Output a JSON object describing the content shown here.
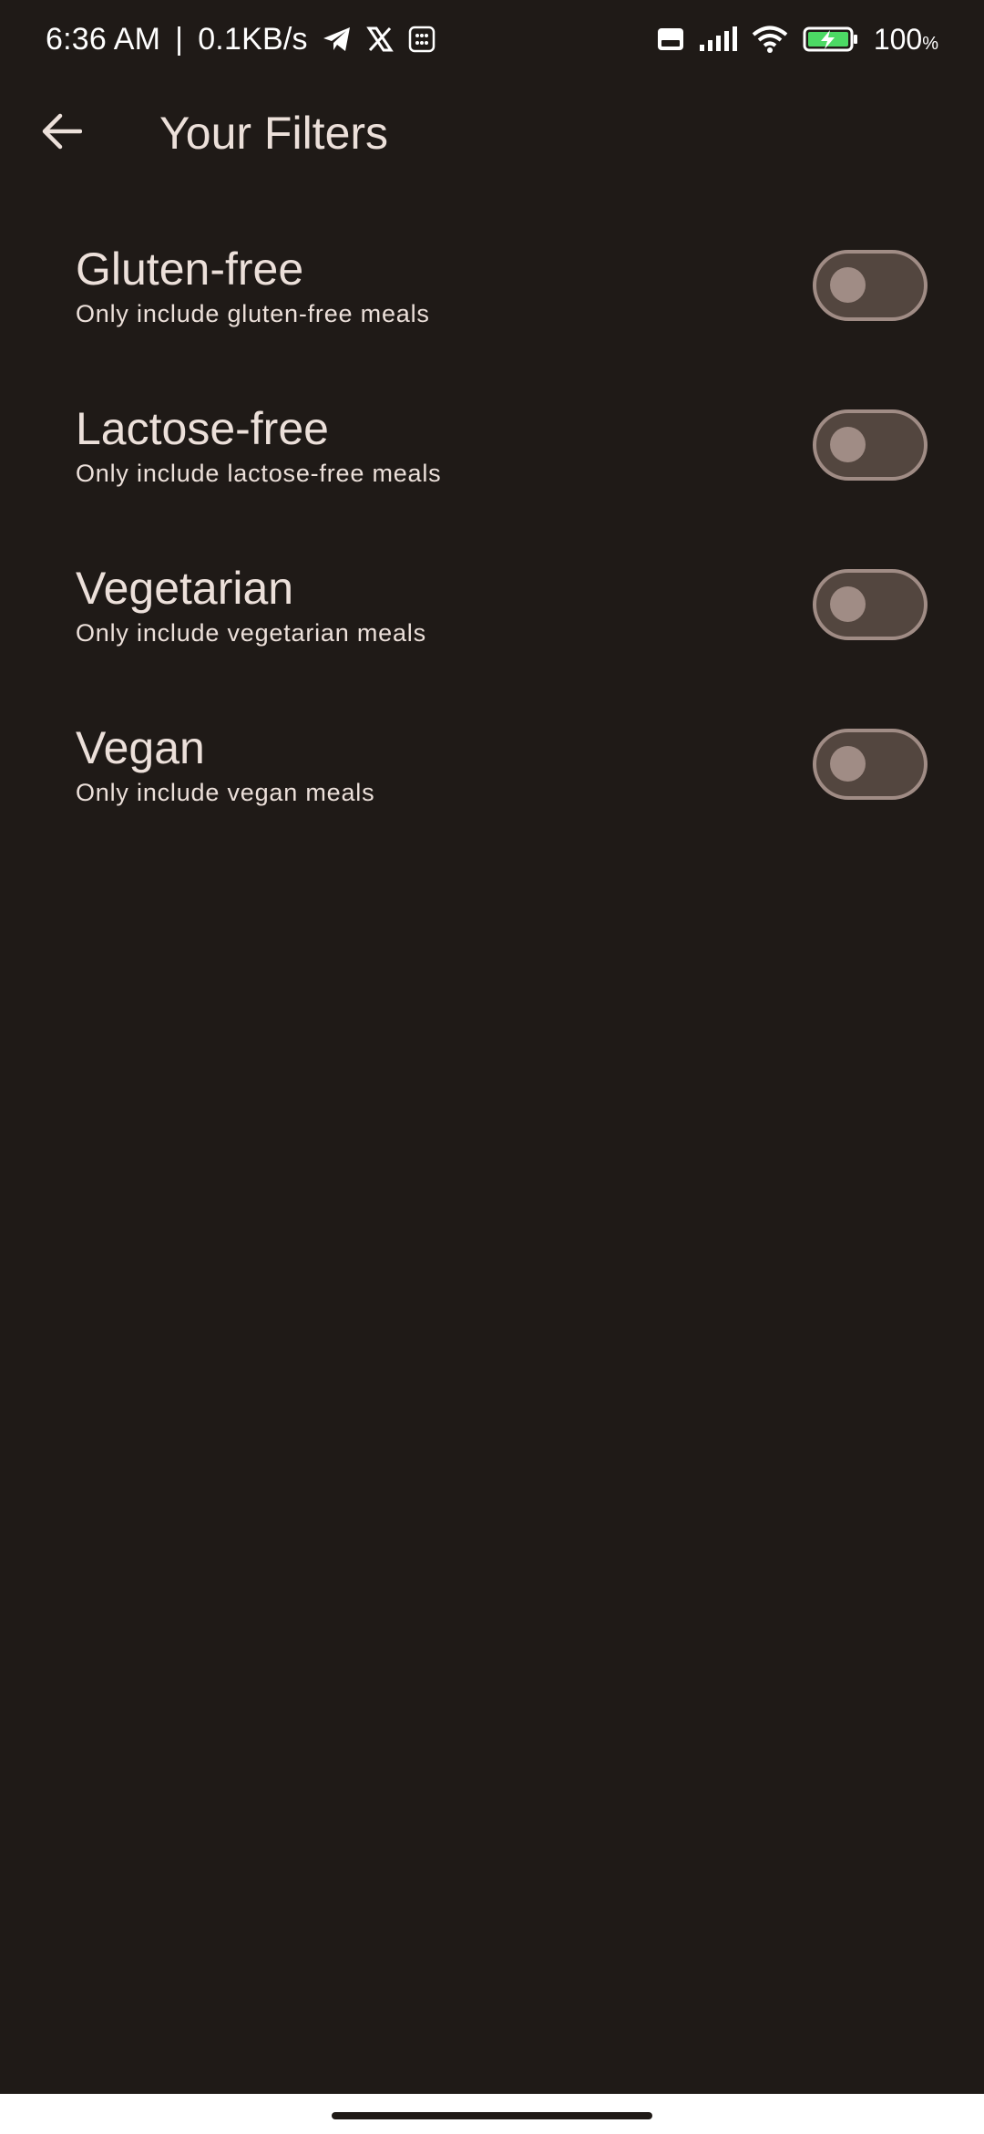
{
  "status_bar": {
    "time": "6:36 AM",
    "separator": "|",
    "network_speed": "0.1KB/s",
    "icons": [
      "telegram-icon",
      "x-icon",
      "app-notification-icon",
      "volte-icon",
      "signal-icon",
      "wifi-icon",
      "battery-charging-icon"
    ],
    "battery_level": "100",
    "battery_unit": "%"
  },
  "app_bar": {
    "back_icon": "arrow-left-icon",
    "title": "Your Filters"
  },
  "filters": [
    {
      "title": "Gluten-free",
      "subtitle": "Only include gluten-free meals",
      "enabled": false
    },
    {
      "title": "Lactose-free",
      "subtitle": "Only include lactose-free meals",
      "enabled": false
    },
    {
      "title": "Vegetarian",
      "subtitle": "Only include vegetarian meals",
      "enabled": false
    },
    {
      "title": "Vegan",
      "subtitle": "Only include vegan meals",
      "enabled": false
    }
  ],
  "colors": {
    "background": "#1f1a17",
    "text": "#ece0da",
    "switch_track_off": "#53463f",
    "switch_outline_off": "#a08c85",
    "battery_green": "#4cd964"
  }
}
